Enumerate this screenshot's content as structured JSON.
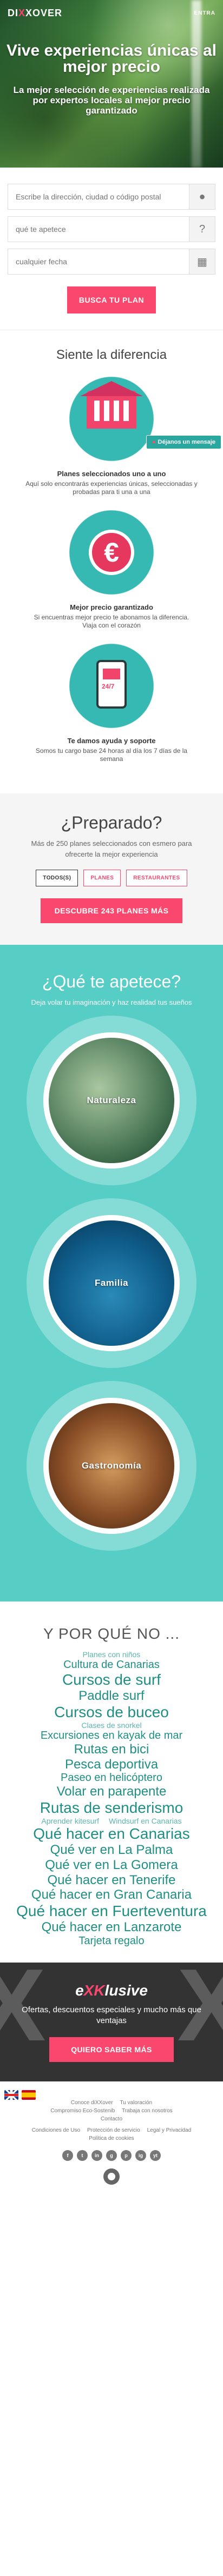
{
  "header": {
    "logo_pre": "DI",
    "logo_x": "X",
    "logo_post": "XOVER",
    "enter_label": "ENTRA"
  },
  "hero": {
    "title": "Vive experiencias únicas al mejor precio",
    "subtitle": "La mejor selección de experiencias realizada por expertos locales al mejor precio garantizado"
  },
  "search": {
    "address_placeholder": "Escribe la dirección, ciudad o código postal",
    "what_placeholder": "qué te apetece",
    "date_placeholder": "cualquier fecha",
    "button": "BUSCA TU PLAN"
  },
  "features": {
    "title": "Siente la diferencia",
    "chip": "Déjanos un mensaje",
    "items": [
      {
        "title": "Planes seleccionados uno a uno",
        "text": "Aquí solo encontrarás experiencias únicas, seleccionadas y probadas para ti una a una"
      },
      {
        "title": "Mejor precio garantizado",
        "text": "Si encuentras mejor precio te abonamos la diferencia.\nViaja con el corazón"
      },
      {
        "title": "Te damos ayuda y soporte",
        "text": "Somos tu cargo base 24 horas al día los 7 días de la semana"
      }
    ],
    "phone_text": "24/7"
  },
  "prepared": {
    "title": "¿Preparado?",
    "text": "Más de 250 planes seleccionados con esmero para ofrecerte la mejor experiencia",
    "filters": [
      "TODOS(S)",
      "PLANES",
      "RESTAURANTES"
    ],
    "button": "DESCUBRE 243 PLANES MÁS"
  },
  "apetece": {
    "title": "¿Qué te apetece?",
    "subtitle": "Deja volar tu imaginación y haz realidad tus sueños",
    "categories": [
      "Naturaleza",
      "Familia",
      "Gastronomía"
    ]
  },
  "porque": {
    "title": "Y POR QUÉ NO ...",
    "tags": [
      "Planes con niños",
      "Cultura de Canarias",
      "Cursos de surf",
      "Paddle surf",
      "Cursos de buceo",
      "Clases de snorkel",
      "Excursiones en kayak de mar",
      "Rutas en bici",
      "Pesca deportiva",
      "Paseo en helicóptero",
      "Volar en parapente",
      "Rutas de senderismo",
      "Aprender kitesurf",
      "Windsurf en Canarias",
      "Qué hacer en Canarias",
      "Qué ver en La Palma",
      "Qué ver en La Gomera",
      "Qué hacer en Tenerife",
      "Qué hacer en Gran Canaria",
      "Qué hacer en Fuerteventura",
      "Qué hacer en Lanzarote",
      "Tarjeta regalo"
    ]
  },
  "exklusive": {
    "title_pre": "e",
    "title_x": "XK",
    "title_post": "lusive",
    "text": "Ofertas, descuentos especiales y mucho más que ventajas",
    "button": "QUIERO SABER MÁS"
  },
  "footer": {
    "links_row1": [
      "Conoce diXXover",
      "Tu valoración"
    ],
    "links_row2": [
      "Compromiso Eco-Sostenib",
      "Trabaja con nosotros"
    ],
    "links_row3": [
      "Contacto"
    ],
    "links_row4": [
      "Condiciones de Uso",
      "Protección de servicio",
      "Legal y Privacidad"
    ],
    "links_row5": [
      "Política de cookies"
    ],
    "social": [
      "f",
      "t",
      "in",
      "g",
      "p",
      "ig",
      "yt"
    ]
  }
}
